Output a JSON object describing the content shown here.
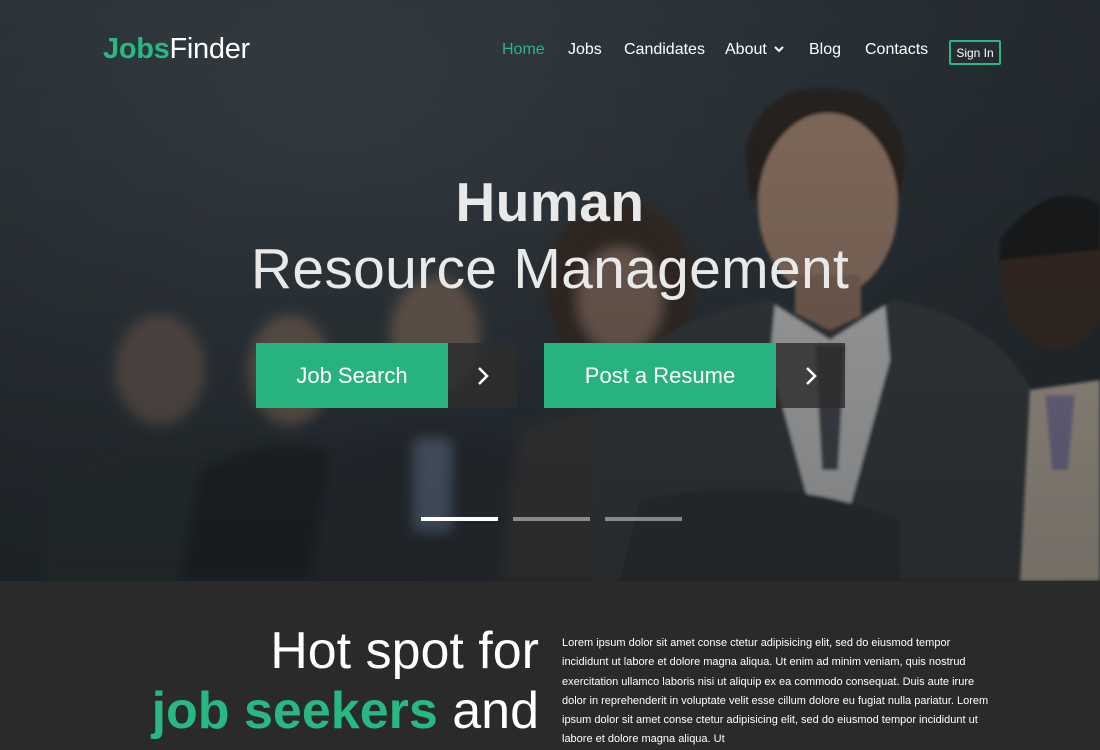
{
  "header": {
    "logo_part1": "Jobs",
    "logo_part2": "Finder",
    "nav": [
      {
        "label": "Home",
        "active": true
      },
      {
        "label": "Jobs"
      },
      {
        "label": "Candidates"
      },
      {
        "label": "About"
      },
      {
        "label": "Blog"
      },
      {
        "label": "Contacts"
      }
    ],
    "signin_label": "Sign In"
  },
  "hero": {
    "title_line1": "Human",
    "title_line2": "Resource Management",
    "buttons": [
      {
        "label": "Job Search"
      },
      {
        "label": "Post a Resume"
      }
    ],
    "slides": {
      "count": 3,
      "active": 1
    }
  },
  "section": {
    "heading_line1": "Hot spot for",
    "heading_accent": "job seekers",
    "heading_rest": "and",
    "paragraph": "Lorem ipsum dolor sit amet conse ctetur adipisicing elit, sed do eiusmod tempor incididunt ut labore et dolore magna aliqua. Ut enim ad minim veniam, quis nostrud exercitation ullamco laboris nisi ut aliquip ex ea commodo consequat. Duis aute irure dolor in reprehenderit in voluptate velit esse cillum dolore eu fugiat nulla pariatur.  Lorem ipsum dolor sit amet conse ctetur adipisicing elit, sed do eiusmod tempor incididunt ut labore et dolore magna aliqua. Ut"
  },
  "colors": {
    "accent": "#27b884",
    "hero_bg": "#2b3238",
    "section_bg": "#2a2a2b"
  },
  "icons": [
    "chevron-down-icon",
    "chevron-right-icon"
  ]
}
